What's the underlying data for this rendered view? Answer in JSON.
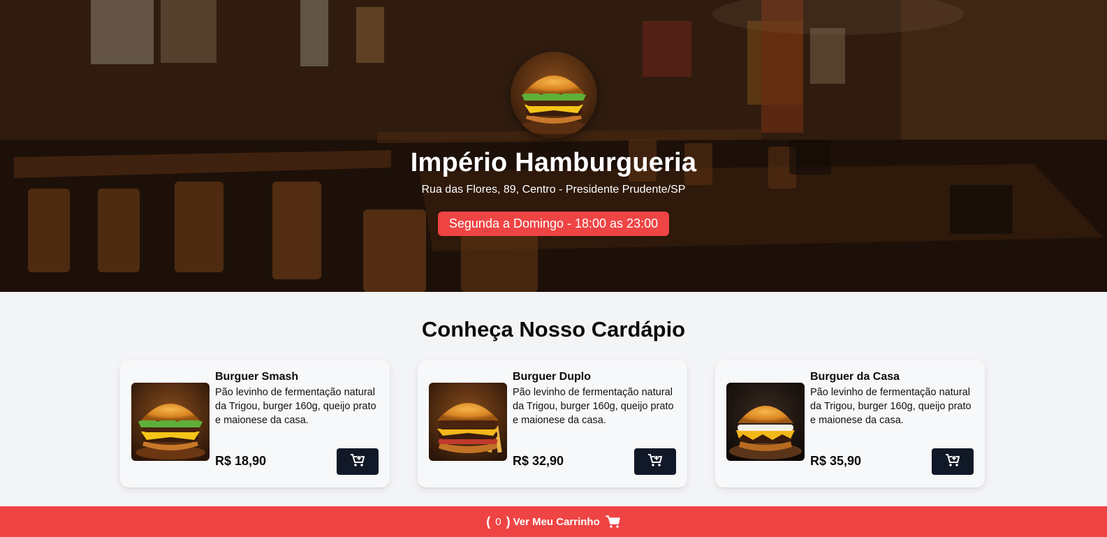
{
  "hero": {
    "name": "Império Hamburgueria",
    "address": "Rua das Flores, 89, Centro - Presidente Prudente/SP",
    "hours": "Segunda a Domingo - 18:00 as 23:00",
    "logo_icon": "burger-logo-icon"
  },
  "menu": {
    "title": "Conheça Nosso Cardápio",
    "items": [
      {
        "name": "Burguer Smash",
        "description": "Pão levinho de fermentação natural da Trigou, burger 160g, queijo prato e maionese da casa.",
        "price": "R$ 18,90",
        "icon": "add-to-cart-icon"
      },
      {
        "name": "Burguer Duplo",
        "description": "Pão levinho de fermentação natural da Trigou, burger 160g, queijo prato e maionese da casa.",
        "price": "R$ 32,90",
        "icon": "add-to-cart-icon"
      },
      {
        "name": "Burguer da Casa",
        "description": "Pão levinho de fermentação natural da Trigou, burger 160g, queijo prato e maionese da casa.",
        "price": "R$ 35,90",
        "icon": "add-to-cart-icon"
      }
    ]
  },
  "cart": {
    "open_paren": "(",
    "count": "0",
    "close_paren": ")",
    "label": "Ver Meu Carrinho",
    "icon": "cart-icon"
  },
  "colors": {
    "accent": "#ef4444",
    "button_dark": "#111827",
    "background": "#f3f4f6"
  }
}
